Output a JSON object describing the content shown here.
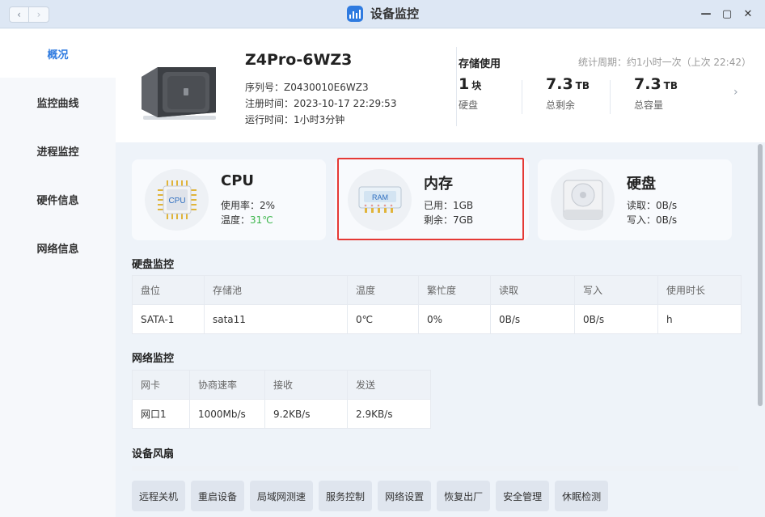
{
  "window": {
    "title": "设备监控",
    "nav_back": "‹",
    "nav_forward": "›",
    "minimize": "—",
    "maximize": "▢",
    "close": "✕"
  },
  "sidebar": {
    "items": [
      {
        "label": "概况",
        "active": true
      },
      {
        "label": "监控曲线"
      },
      {
        "label": "进程监控"
      },
      {
        "label": "硬件信息"
      },
      {
        "label": "网络信息"
      }
    ]
  },
  "device": {
    "name": "Z4Pro-6WZ3",
    "serial": "序列号：Z0430010E6WZ3",
    "registered": "注册时间：2023-10-17 22:29:53",
    "uptime": "运行时间：1小时3分钟"
  },
  "storage": {
    "title": "存储使用",
    "period": "统计周期：约1小时一次（上次 22:42）",
    "disks_num": "1",
    "disks_unit": "块",
    "disks_label": "硬盘",
    "free_num": "7.3",
    "free_unit": "TB",
    "free_label": "总剩余",
    "total_num": "7.3",
    "total_unit": "TB",
    "total_label": "总容量",
    "chevron": "›"
  },
  "cards": {
    "cpu": {
      "title": "CPU",
      "icon_text": "CPU",
      "usage": "使用率：2%",
      "temp_label": "温度：",
      "temp_value": "31℃"
    },
    "memory": {
      "title": "内存",
      "icon_text": "RAM",
      "used": "已用：1GB",
      "free": "剩余：7GB"
    },
    "disk": {
      "title": "硬盘",
      "read": "读取：0B/s",
      "write": "写入：0B/s"
    }
  },
  "disk_monitor": {
    "title": "硬盘监控",
    "headers": [
      "盘位",
      "存储池",
      "温度",
      "繁忙度",
      "读取",
      "写入",
      "使用时长"
    ],
    "rows": [
      [
        "SATA-1",
        "sata11",
        "0℃",
        "0%",
        "0B/s",
        "0B/s",
        "h"
      ]
    ]
  },
  "net_monitor": {
    "title": "网络监控",
    "headers": [
      "网卡",
      "协商速率",
      "接收",
      "发送"
    ],
    "rows": [
      [
        "网口1",
        "1000Mb/s",
        "9.2KB/s",
        "2.9KB/s"
      ]
    ]
  },
  "fan": {
    "title": "设备风扇"
  },
  "actions": [
    "远程关机",
    "重启设备",
    "局域网测速",
    "服务控制",
    "网络设置",
    "恢复出厂",
    "安全管理",
    "休眠检测"
  ],
  "colors": {
    "accent": "#2f7be0",
    "highlight": "#e53935",
    "temp_ok": "#3bb54a"
  }
}
